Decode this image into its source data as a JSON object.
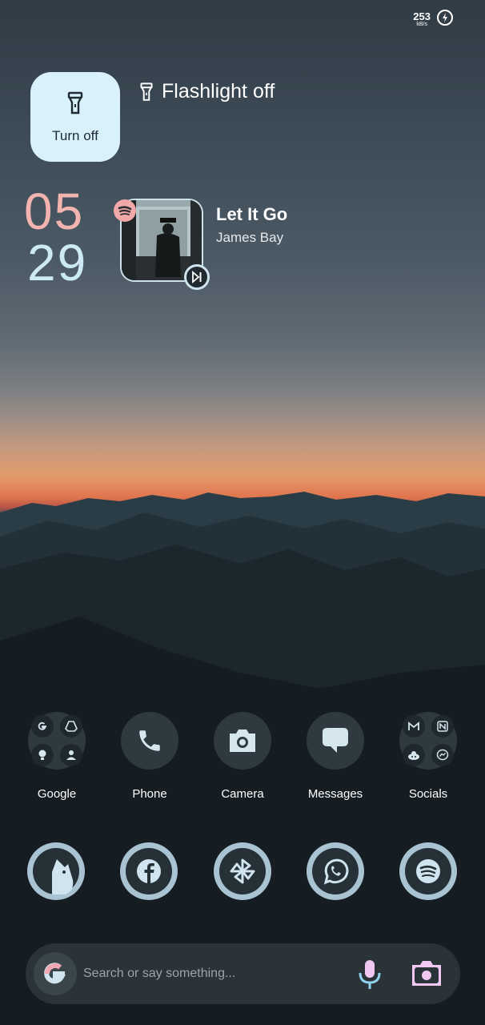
{
  "status_bar": {
    "network_speed": "253",
    "network_unit": "kB/s",
    "charging_icon": "charging-icon"
  },
  "flashlight": {
    "tile_label": "Turn off",
    "notification_title": "Flashlight off"
  },
  "clock": {
    "hours": "05",
    "minutes": "29"
  },
  "media": {
    "song_title": "Let It Go",
    "artist": "James Bay",
    "source_app_icon": "spotify-icon"
  },
  "home_apps": [
    {
      "label": "Google"
    },
    {
      "label": "Phone"
    },
    {
      "label": "Camera"
    },
    {
      "label": "Messages"
    },
    {
      "label": "Socials"
    }
  ],
  "hotseat": [
    {
      "icon": "dog-app-icon"
    },
    {
      "icon": "facebook-icon"
    },
    {
      "icon": "pinwheel-icon"
    },
    {
      "icon": "whatsapp-icon"
    },
    {
      "icon": "spotify-icon"
    }
  ],
  "search_bar": {
    "placeholder": "Search or say something..."
  },
  "colors": {
    "tile_bg": "#d8f1fb",
    "clock_hours": "#f3b4b0",
    "clock_minutes": "#cde9f3",
    "hotseat_ring": "#a9c3d3"
  }
}
